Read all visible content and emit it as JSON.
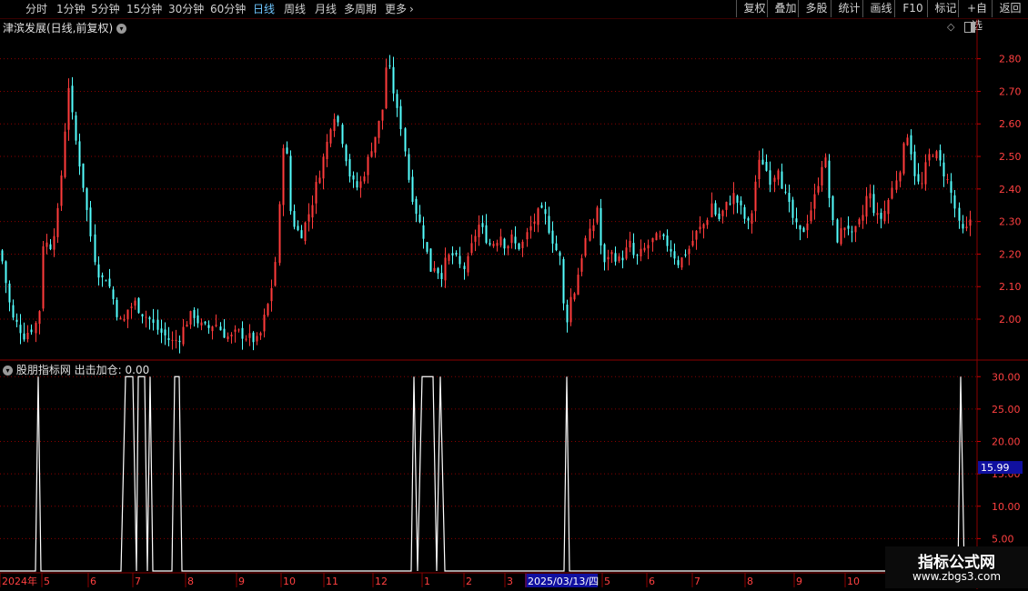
{
  "toolbar": {
    "periods": [
      "分时",
      "1分钟",
      "5分钟",
      "15分钟",
      "30分钟",
      "60分钟",
      "日线",
      "周线",
      "月线",
      "多周期",
      "更多"
    ],
    "active_index": 6,
    "right_buttons": [
      "复权",
      "叠加",
      "多股",
      "统计",
      "画线",
      "F10",
      "标记",
      "+自选",
      "返回"
    ]
  },
  "main_panel": {
    "title": "津滨发展(日线,前复权)",
    "price_ticks": [
      "2.80",
      "2.70",
      "2.60",
      "2.50",
      "2.40",
      "2.30",
      "2.20",
      "2.10",
      "2.00"
    ]
  },
  "indicator_panel": {
    "title": "股朋指标网 出击加仓: 0.00",
    "ticks": [
      "30.00",
      "25.00",
      "20.00",
      "15.00",
      "10.00",
      "5.00"
    ],
    "current_value": "15.99"
  },
  "date_axis": {
    "labels": [
      "2024年",
      "5",
      "6",
      "7",
      "8",
      "9",
      "10",
      "11",
      "12",
      "1",
      "2",
      "3",
      "2025/03/13/四",
      "5",
      "6",
      "7",
      "8",
      "9",
      "10"
    ]
  },
  "watermark": {
    "title": "指标公式网",
    "url": "www.zbgs3.com"
  },
  "colors": {
    "up": "#ff3b3b",
    "down": "#54ffff",
    "grid": "#8b0000",
    "active_tab": "#6ec6ff"
  },
  "chart_data": [
    {
      "type": "candlestick",
      "title": "津滨发展(日线,前复权)",
      "ylim": [
        1.88,
        2.88
      ],
      "x_range": [
        "2024年",
        "10"
      ],
      "close_path": [
        [
          0,
          2.21
        ],
        [
          5,
          2.13
        ],
        [
          10,
          2.05
        ],
        [
          14,
          2.0
        ],
        [
          20,
          1.98
        ],
        [
          26,
          1.95
        ],
        [
          34,
          1.97
        ],
        [
          42,
          2.0
        ],
        [
          48,
          2.3
        ],
        [
          52,
          2.2
        ],
        [
          58,
          2.26
        ],
        [
          64,
          2.34
        ],
        [
          70,
          2.55
        ],
        [
          75,
          2.72
        ],
        [
          80,
          2.6
        ],
        [
          86,
          2.5
        ],
        [
          92,
          2.4
        ],
        [
          98,
          2.28
        ],
        [
          104,
          2.18
        ],
        [
          110,
          2.12
        ],
        [
          116,
          2.13
        ],
        [
          122,
          2.08
        ],
        [
          128,
          2.02
        ],
        [
          134,
          1.98
        ],
        [
          140,
          2.03
        ],
        [
          148,
          2.05
        ],
        [
          156,
          2.02
        ],
        [
          164,
          2.0
        ],
        [
          172,
          1.97
        ],
        [
          180,
          1.95
        ],
        [
          188,
          1.93
        ],
        [
          196,
          1.94
        ],
        [
          204,
          1.99
        ],
        [
          212,
          2.02
        ],
        [
          220,
          1.98
        ],
        [
          228,
          1.97
        ],
        [
          236,
          1.99
        ],
        [
          244,
          1.96
        ],
        [
          252,
          1.94
        ],
        [
          260,
          1.96
        ],
        [
          268,
          1.95
        ],
        [
          276,
          1.94
        ],
        [
          284,
          1.93
        ],
        [
          290,
          2.0
        ],
        [
          296,
          2.06
        ],
        [
          302,
          2.16
        ],
        [
          308,
          2.4
        ],
        [
          312,
          2.62
        ],
        [
          318,
          2.34
        ],
        [
          324,
          2.28
        ],
        [
          330,
          2.26
        ],
        [
          336,
          2.3
        ],
        [
          342,
          2.35
        ],
        [
          348,
          2.42
        ],
        [
          354,
          2.48
        ],
        [
          360,
          2.55
        ],
        [
          366,
          2.64
        ],
        [
          372,
          2.6
        ],
        [
          378,
          2.52
        ],
        [
          384,
          2.44
        ],
        [
          390,
          2.4
        ],
        [
          396,
          2.42
        ],
        [
          402,
          2.47
        ],
        [
          408,
          2.53
        ],
        [
          414,
          2.58
        ],
        [
          420,
          2.64
        ],
        [
          425,
          2.8
        ],
        [
          430,
          2.74
        ],
        [
          436,
          2.64
        ],
        [
          442,
          2.58
        ],
        [
          448,
          2.44
        ],
        [
          454,
          2.36
        ],
        [
          460,
          2.3
        ],
        [
          466,
          2.25
        ],
        [
          472,
          2.15
        ],
        [
          478,
          2.17
        ],
        [
          484,
          2.13
        ],
        [
          490,
          2.18
        ],
        [
          496,
          2.2
        ],
        [
          502,
          2.18
        ],
        [
          508,
          2.15
        ],
        [
          514,
          2.18
        ],
        [
          520,
          2.25
        ],
        [
          526,
          2.29
        ],
        [
          532,
          2.26
        ],
        [
          538,
          2.23
        ],
        [
          544,
          2.24
        ],
        [
          550,
          2.26
        ],
        [
          556,
          2.22
        ],
        [
          562,
          2.25
        ],
        [
          568,
          2.22
        ],
        [
          574,
          2.23
        ],
        [
          580,
          2.27
        ],
        [
          586,
          2.3
        ],
        [
          592,
          2.33
        ],
        [
          598,
          2.32
        ],
        [
          604,
          2.27
        ],
        [
          610,
          2.22
        ],
        [
          616,
          2.18
        ],
        [
          621,
          1.96
        ],
        [
          626,
          2.06
        ],
        [
          632,
          2.09
        ],
        [
          638,
          2.18
        ],
        [
          644,
          2.25
        ],
        [
          650,
          2.27
        ],
        [
          656,
          2.35
        ],
        [
          662,
          2.15
        ],
        [
          668,
          2.2
        ],
        [
          674,
          2.2
        ],
        [
          680,
          2.18
        ],
        [
          686,
          2.2
        ],
        [
          692,
          2.23
        ],
        [
          698,
          2.18
        ],
        [
          704,
          2.2
        ],
        [
          710,
          2.22
        ],
        [
          716,
          2.24
        ],
        [
          722,
          2.25
        ],
        [
          728,
          2.24
        ],
        [
          734,
          2.23
        ],
        [
          740,
          2.2
        ],
        [
          746,
          2.17
        ],
        [
          752,
          2.2
        ],
        [
          758,
          2.22
        ],
        [
          764,
          2.26
        ],
        [
          770,
          2.28
        ],
        [
          776,
          2.3
        ],
        [
          782,
          2.36
        ],
        [
          788,
          2.3
        ],
        [
          794,
          2.33
        ],
        [
          800,
          2.36
        ],
        [
          806,
          2.38
        ],
        [
          812,
          2.35
        ],
        [
          818,
          2.31
        ],
        [
          824,
          2.28
        ],
        [
          830,
          2.42
        ],
        [
          836,
          2.5
        ],
        [
          842,
          2.46
        ],
        [
          848,
          2.42
        ],
        [
          854,
          2.48
        ],
        [
          860,
          2.4
        ],
        [
          866,
          2.35
        ],
        [
          872,
          2.3
        ],
        [
          878,
          2.26
        ],
        [
          884,
          2.28
        ],
        [
          890,
          2.33
        ],
        [
          896,
          2.38
        ],
        [
          902,
          2.46
        ],
        [
          906,
          2.52
        ],
        [
          912,
          2.36
        ],
        [
          918,
          2.24
        ],
        [
          924,
          2.27
        ],
        [
          930,
          2.3
        ],
        [
          936,
          2.25
        ],
        [
          942,
          2.28
        ],
        [
          948,
          2.32
        ],
        [
          954,
          2.4
        ],
        [
          960,
          2.34
        ],
        [
          966,
          2.3
        ],
        [
          972,
          2.33
        ],
        [
          978,
          2.38
        ],
        [
          984,
          2.43
        ],
        [
          990,
          2.48
        ],
        [
          996,
          2.58
        ],
        [
          1000,
          2.53
        ],
        [
          1006,
          2.43
        ],
        [
          1012,
          2.4
        ],
        [
          1018,
          2.48
        ],
        [
          1024,
          2.52
        ],
        [
          1030,
          2.5
        ],
        [
          1036,
          2.46
        ],
        [
          1042,
          2.42
        ],
        [
          1048,
          2.36
        ],
        [
          1054,
          2.28
        ],
        [
          1060,
          2.26
        ],
        [
          1066,
          2.31
        ]
      ]
    },
    {
      "type": "line",
      "title": "股朋指标网 出击加仓",
      "ylim": [
        0,
        32
      ],
      "series": [
        {
          "name": "出击加仓",
          "points": [
            [
              0,
              0
            ],
            [
              39,
              0
            ],
            [
              42,
              30
            ],
            [
              45,
              0
            ],
            [
              133,
              0
            ],
            [
              138,
              30
            ],
            [
              146,
              30
            ],
            [
              150,
              0
            ],
            [
              152,
              30
            ],
            [
              159,
              30
            ],
            [
              162,
              0
            ],
            [
              165,
              30
            ],
            [
              168,
              0
            ],
            [
              189,
              0
            ],
            [
              192,
              30
            ],
            [
              197,
              30
            ],
            [
              200,
              0
            ],
            [
              452,
              0
            ],
            [
              455,
              30
            ],
            [
              459,
              0
            ],
            [
              464,
              30
            ],
            [
              476,
              30
            ],
            [
              480,
              0
            ],
            [
              484,
              30
            ],
            [
              489,
              0
            ],
            [
              620,
              0
            ],
            [
              623,
              30
            ],
            [
              626,
              0
            ],
            [
              1053,
              0
            ],
            [
              1056,
              30
            ],
            [
              1060,
              0
            ],
            [
              1070,
              0
            ]
          ]
        }
      ]
    }
  ]
}
